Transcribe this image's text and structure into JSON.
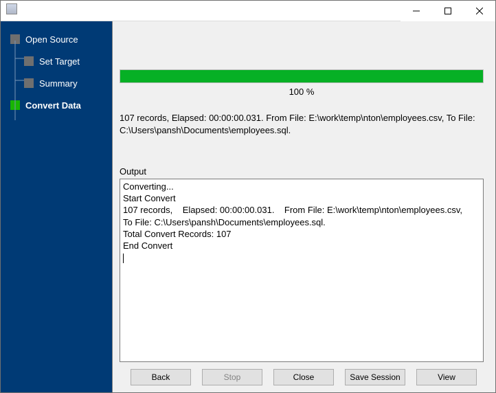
{
  "titlebar": {
    "title": ""
  },
  "sidebar": {
    "items": [
      {
        "label": "Open Source",
        "level": 0,
        "active": false
      },
      {
        "label": "Set Target",
        "level": 1,
        "active": false
      },
      {
        "label": "Summary",
        "level": 1,
        "active": false
      },
      {
        "label": "Convert Data",
        "level": 0,
        "active": true
      }
    ]
  },
  "progress": {
    "percent": 100,
    "label": "100 %"
  },
  "status": "107 records,    Elapsed: 00:00:00.031.    From File: E:\\work\\temp\\nton\\employees.csv,    To File: C:\\Users\\pansh\\Documents\\employees.sql.",
  "output": {
    "label": "Output",
    "lines": [
      "Converting...",
      "Start Convert",
      "107 records,    Elapsed: 00:00:00.031.    From File: E:\\work\\temp\\nton\\employees.csv,    To File: C:\\Users\\pansh\\Documents\\employees.sql.",
      "Total Convert Records: 107",
      "End Convert"
    ]
  },
  "buttons": {
    "back": "Back",
    "stop": "Stop",
    "close": "Close",
    "save": "Save Session",
    "view": "View"
  }
}
